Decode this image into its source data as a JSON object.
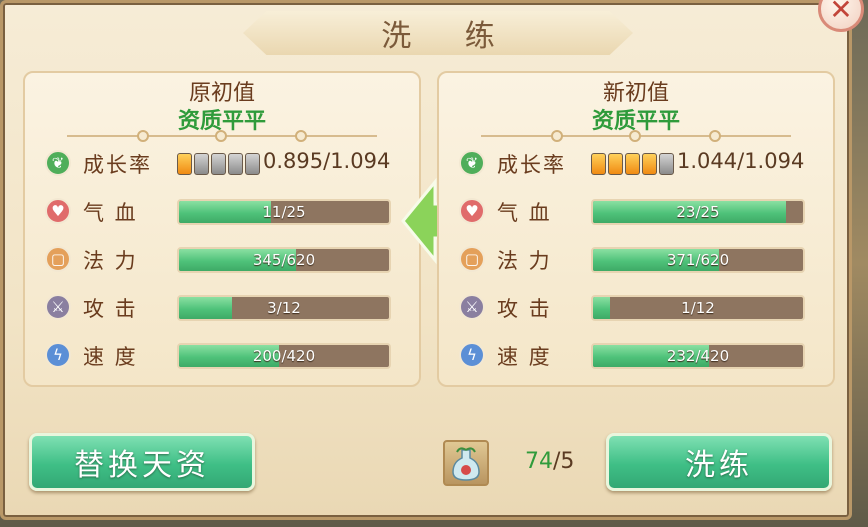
{
  "dialog": {
    "title": "洗 练",
    "close_label": "✕"
  },
  "left_panel": {
    "heading": "原初值",
    "quality": "资质平平",
    "stats": [
      {
        "label": "成长率",
        "icon": "sprout-icon",
        "value_text": "0.895/1.094",
        "pips_on": 1,
        "pips_total": 5
      },
      {
        "label": "气 血",
        "icon": "heart-icon",
        "value_text": "11/25",
        "fraction": 0.44
      },
      {
        "label": "法 力",
        "icon": "scroll-icon",
        "value_text": "345/620",
        "fraction": 0.556
      },
      {
        "label": "攻 击",
        "icon": "sword-icon",
        "value_text": "3/12",
        "fraction": 0.25
      },
      {
        "label": "速 度",
        "icon": "lightning-icon",
        "value_text": "200/420",
        "fraction": 0.476
      }
    ]
  },
  "right_panel": {
    "heading": "新初值",
    "quality": "资质平平",
    "stats": [
      {
        "label": "成长率",
        "icon": "sprout-icon",
        "value_text": "1.044/1.094",
        "pips_on": 4,
        "pips_total": 5
      },
      {
        "label": "气 血",
        "icon": "heart-icon",
        "value_text": "23/25",
        "fraction": 0.92
      },
      {
        "label": "法 力",
        "icon": "scroll-icon",
        "value_text": "371/620",
        "fraction": 0.598
      },
      {
        "label": "攻 击",
        "icon": "sword-icon",
        "value_text": "1/12",
        "fraction": 0.083
      },
      {
        "label": "速 度",
        "icon": "lightning-icon",
        "value_text": "232/420",
        "fraction": 0.552
      }
    ]
  },
  "actions": {
    "replace_label": "替换天资",
    "refine_label": "洗练",
    "item_icon": "potion-icon",
    "item_have": "74",
    "item_need": "/5"
  },
  "colors": {
    "accent_green": "#3fbf86",
    "quality_green": "#2f9b3b",
    "title_brown": "#7b5a3a",
    "bar_fill": "#4fc27a",
    "bar_track": "#8e7560"
  }
}
